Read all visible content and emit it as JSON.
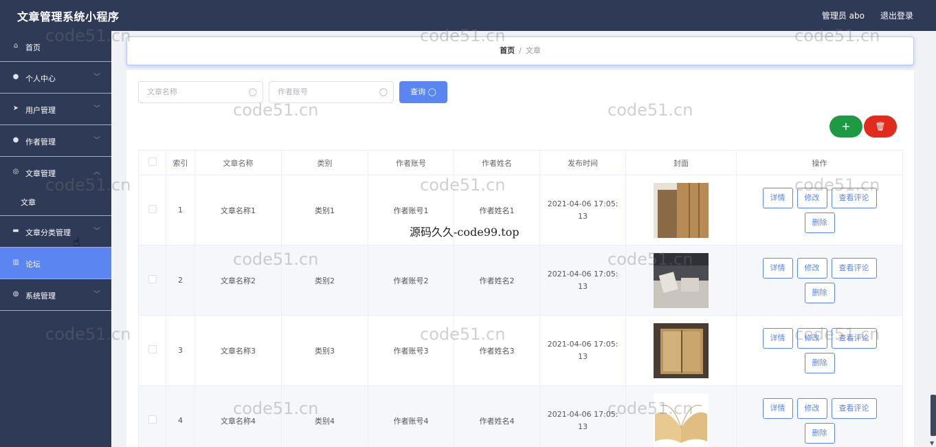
{
  "app": {
    "title": "文章管理系统小程序",
    "user": "管理员 abo",
    "logout": "退出登录"
  },
  "sidebar": {
    "items": [
      {
        "label": "首页",
        "icon": "home-icon",
        "glyph": "⌂"
      },
      {
        "label": "个人中心",
        "icon": "user-icon",
        "glyph": "●"
      },
      {
        "label": "用户管理",
        "icon": "send-icon",
        "glyph": "➤"
      },
      {
        "label": "作者管理",
        "icon": "bulb-icon",
        "glyph": "●"
      },
      {
        "label": "文章管理",
        "icon": "compass-icon",
        "glyph": "◎"
      },
      {
        "label": "文章分类管理",
        "icon": "monitor-icon",
        "glyph": "▬"
      },
      {
        "label": "论坛",
        "icon": "chart-icon",
        "glyph": "▥"
      },
      {
        "label": "系统管理",
        "icon": "mic-icon",
        "glyph": "◍"
      }
    ],
    "sub_item": "文章"
  },
  "breadcrumb": {
    "home": "首页",
    "separator": "/",
    "current": "文章"
  },
  "search": {
    "title_placeholder": "文章名称",
    "account_placeholder": "作者账号",
    "query_label": "查询"
  },
  "buttons": {
    "add": "+",
    "delete": "🗑"
  },
  "table": {
    "headers": [
      "索引",
      "文章名称",
      "类别",
      "作者账号",
      "作者姓名",
      "发布时间",
      "封面",
      "操作"
    ],
    "rows": [
      {
        "index": "1",
        "title": "文章名称1",
        "category": "类别1",
        "account": "作者账号1",
        "name": "作者姓名1",
        "time": "2021-04-06 17:05:13"
      },
      {
        "index": "2",
        "title": "文章名称2",
        "category": "类别2",
        "account": "作者账号2",
        "name": "作者姓名2",
        "time": "2021-04-06 17:05:13"
      },
      {
        "index": "3",
        "title": "文章名称3",
        "category": "类别3",
        "account": "作者账号3",
        "name": "作者姓名3",
        "time": "2021-04-06 17:05:13"
      },
      {
        "index": "4",
        "title": "文章名称4",
        "category": "类别4",
        "account": "作者账号4",
        "name": "作者姓名4",
        "time": "2021-04-06 17:05:13"
      }
    ],
    "ops": {
      "detail": "详情",
      "edit": "修改",
      "comments": "查看评论",
      "delete": "删除"
    }
  },
  "watermarks": {
    "main": "code51.cn",
    "center": "源码久久-code99.top"
  },
  "colors": {
    "sidebar_bg": "#2e3a56",
    "accent": "#5b86f2",
    "add_green": "#1e9a45",
    "delete_red": "#e02b1d"
  }
}
